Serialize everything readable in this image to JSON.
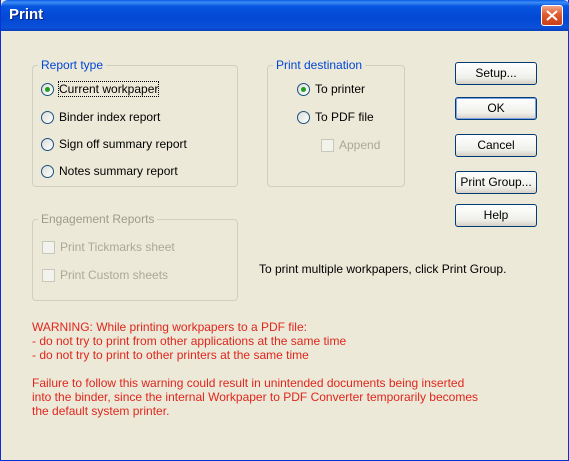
{
  "window": {
    "title": "Print"
  },
  "report_type": {
    "legend": "Report type",
    "options": [
      {
        "label": "Current workpaper",
        "checked": true
      },
      {
        "label": "Binder index report",
        "checked": false
      },
      {
        "label": "Sign off summary report",
        "checked": false
      },
      {
        "label": "Notes summary report",
        "checked": false
      }
    ]
  },
  "print_destination": {
    "legend": "Print destination",
    "to_printer": "To printer",
    "to_pdf": "To PDF file",
    "append": "Append",
    "selected": "To printer"
  },
  "engagement_reports": {
    "legend": "Engagement Reports",
    "tickmarks": "Print Tickmarks sheet",
    "custom": "Print Custom sheets"
  },
  "buttons": {
    "setup": "Setup...",
    "ok": "OK",
    "cancel": "Cancel",
    "print_group": "Print Group...",
    "help": "Help"
  },
  "info_message": "To print multiple workpapers, click Print Group.",
  "warning": {
    "lines": [
      "WARNING: While printing workpapers to a PDF file:",
      " - do not try to print from other applications at the same time",
      " - do not try to print to other printers at the same time"
    ],
    "failure_lines": [
      "Failure to follow this warning could result in unintended documents being inserted",
      "into the binder, since the internal Workpaper to PDF Converter temporarily becomes",
      "the default system printer."
    ]
  },
  "colors": {
    "title_bar": "#0a4fd8",
    "warning_text": "#e0261d",
    "legend_text": "#0046d5"
  }
}
